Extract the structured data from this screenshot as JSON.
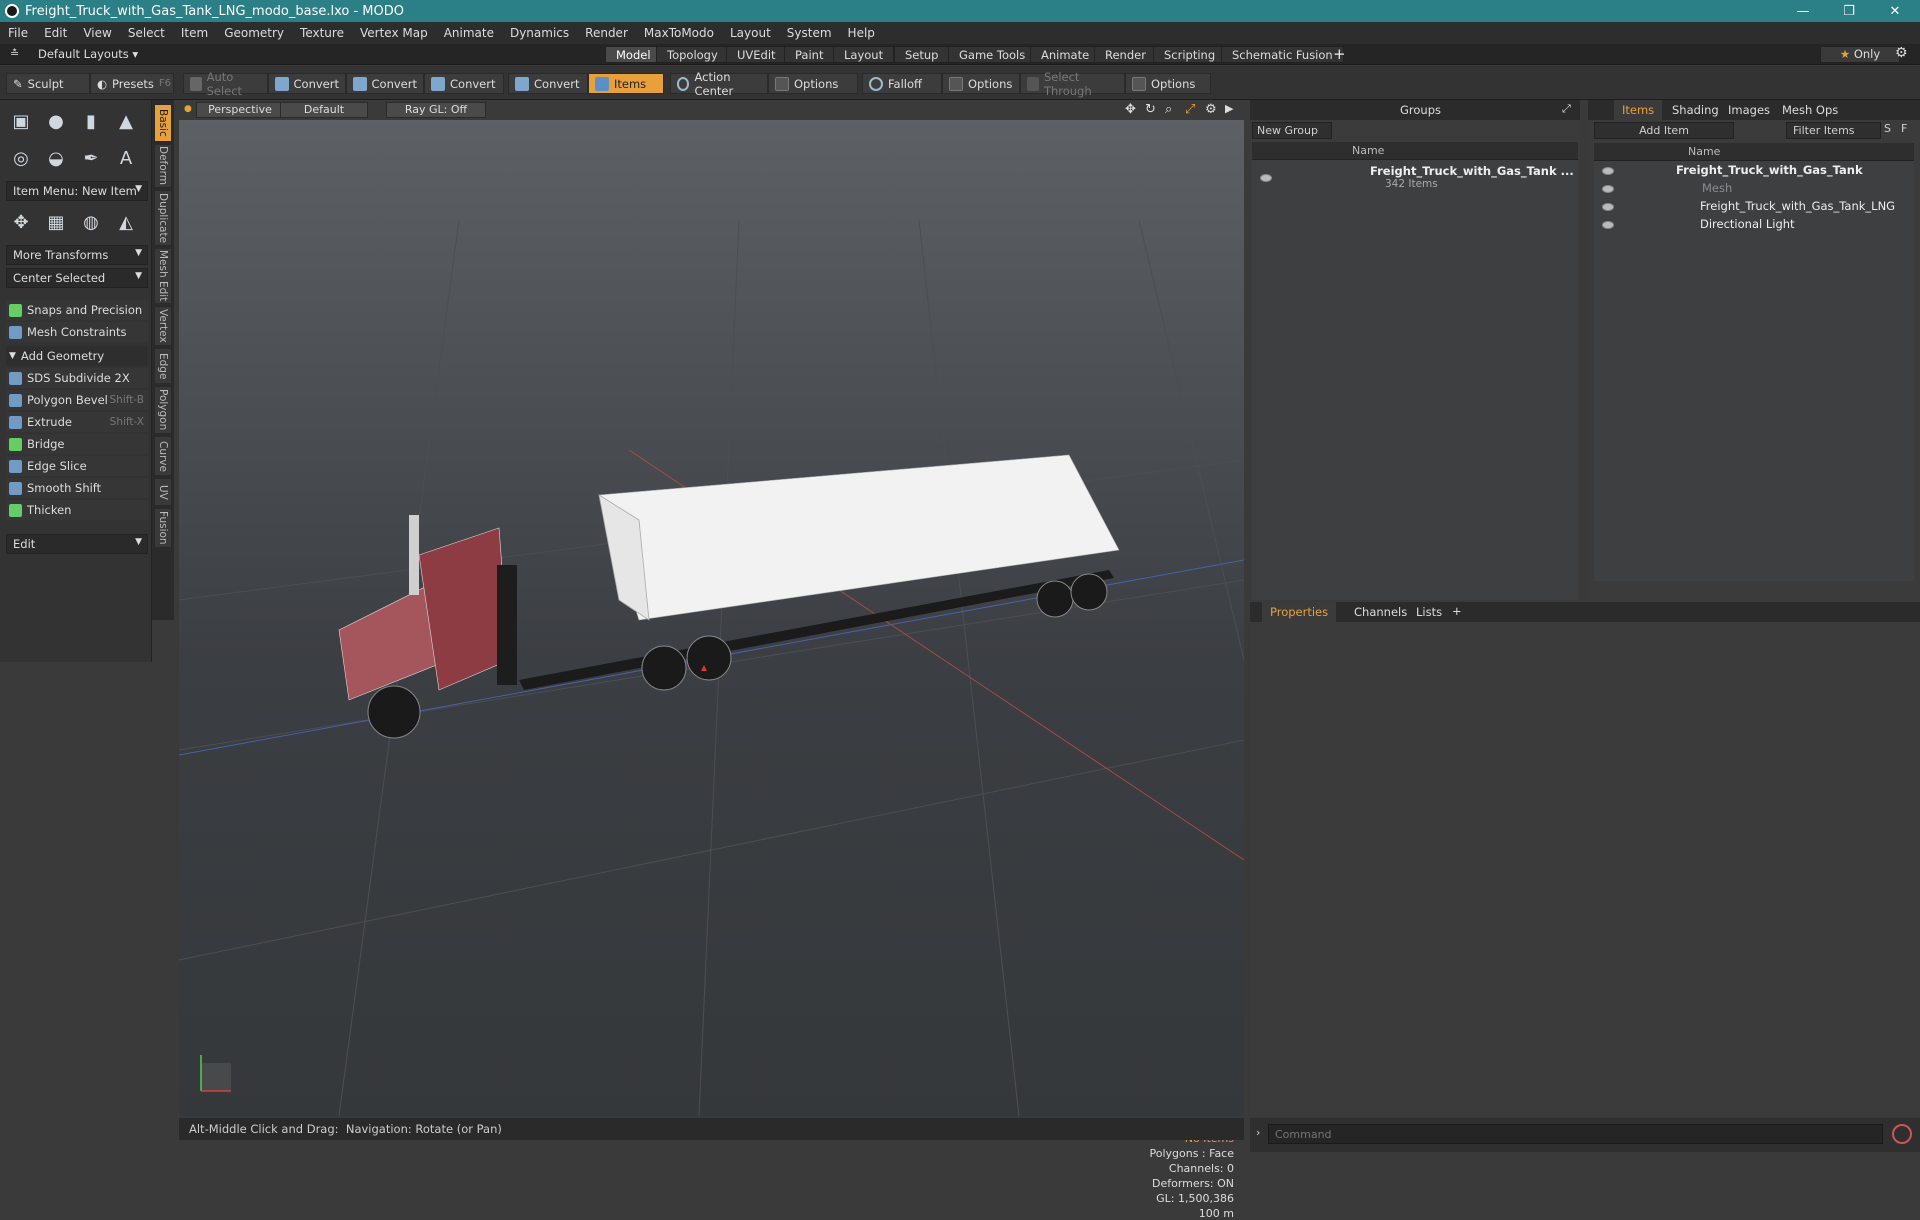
{
  "window": {
    "title": "Freight_Truck_with_Gas_Tank_LNG_modo_base.lxo - MODO",
    "minimize": "—",
    "maximize": "❐",
    "close": "✕"
  },
  "menu": [
    "File",
    "Edit",
    "View",
    "Select",
    "Item",
    "Geometry",
    "Texture",
    "Vertex Map",
    "Animate",
    "Dynamics",
    "Render",
    "MaxToModo",
    "Layout",
    "System",
    "Help"
  ],
  "layoutbar": {
    "layouts_label": "Default Layouts",
    "tabs": [
      "Model",
      "Topology",
      "UVEdit",
      "Paint",
      "Layout",
      "Setup",
      "Game Tools",
      "Animate",
      "Render",
      "Scripting",
      "Schematic Fusion"
    ],
    "add": "+",
    "only": "Only"
  },
  "toolbar": {
    "sculpt": "Sculpt",
    "presets": "Presets",
    "presets_key": "F6",
    "auto_select": "Auto Select",
    "convert": "Convert",
    "items": "Items",
    "action_center": "Action Center",
    "options": "Options",
    "falloff": "Falloff",
    "select_through": "Select Through"
  },
  "leftpanel": {
    "item_menu": "Item Menu: New Item",
    "more_transforms": "More Transforms",
    "center_selected": "Center Selected",
    "snaps": "Snaps and Precision",
    "mesh_constraints": "Mesh Constraints",
    "add_geometry": "Add Geometry",
    "tools": [
      {
        "label": "SDS Subdivide 2X",
        "shortcut": ""
      },
      {
        "label": "Polygon Bevel",
        "shortcut": "Shift-B"
      },
      {
        "label": "Extrude",
        "shortcut": "Shift-X"
      },
      {
        "label": "Bridge",
        "shortcut": ""
      },
      {
        "label": "Edge Slice",
        "shortcut": ""
      },
      {
        "label": "Smooth Shift",
        "shortcut": ""
      },
      {
        "label": "Thicken",
        "shortcut": ""
      }
    ],
    "edit": "Edit"
  },
  "vtabs": [
    "Basic",
    "Deform",
    "Duplicate",
    "Mesh Edit",
    "Vertex",
    "Edge",
    "Polygon",
    "Curve",
    "UV",
    "Fusion"
  ],
  "viewport": {
    "perspective": "Perspective",
    "default": "Default",
    "raygl": "Ray GL: Off",
    "info": {
      "no_items": "No Items",
      "polygons": "Polygons : Face",
      "channels": "Channels: 0",
      "deformers": "Deformers: ON",
      "gl": "GL: 1,500,386",
      "scale": "100 m"
    }
  },
  "status": {
    "hint": "Alt-Middle Click and Drag:",
    "action": "Navigation: Rotate (or Pan)"
  },
  "groups": {
    "title": "Groups",
    "new_group": "New Group",
    "name_col": "Name",
    "entry_name": "Freight_Truck_with_Gas_Tank ...",
    "entry_count": "342 Items"
  },
  "items": {
    "tabs": [
      "Items",
      "Shading",
      "Images",
      "Mesh Ops"
    ],
    "add_item": "Add Item",
    "filter": "Filter Items",
    "s": "S",
    "f": "F",
    "name_col": "Name",
    "tree": [
      {
        "label": "Freight_Truck_with_Gas_Tank",
        "bold": true,
        "indent": 0
      },
      {
        "label": "Mesh",
        "bold": false,
        "indent": 1,
        "dim": true
      },
      {
        "label": "Freight_Truck_with_Gas_Tank_LNG",
        "bold": false,
        "indent": 1
      },
      {
        "label": "Directional Light",
        "bold": false,
        "indent": 1
      }
    ]
  },
  "props": {
    "tabs": [
      "Properties",
      "Channels",
      "Lists"
    ],
    "add": "+"
  },
  "command": {
    "placeholder": "Command"
  },
  "colors": {
    "accent": "#e8a13a",
    "titlebar": "#2b7f86"
  }
}
